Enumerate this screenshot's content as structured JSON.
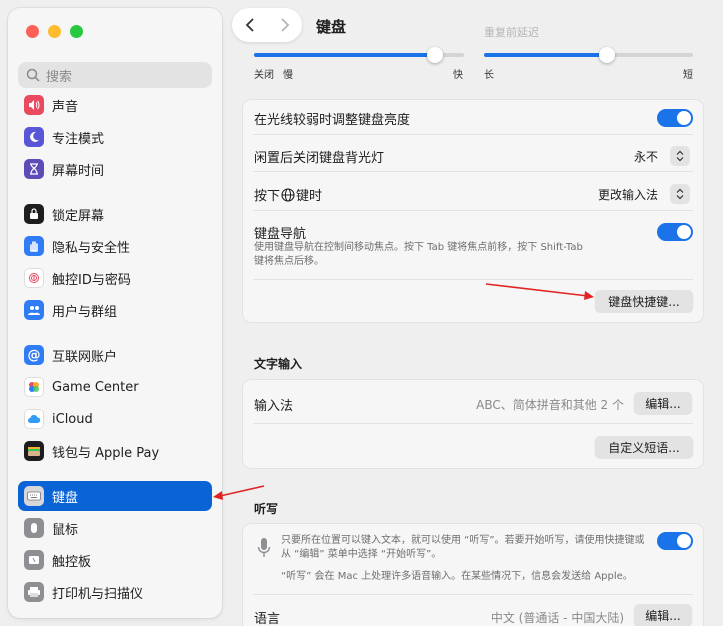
{
  "sidebar": {
    "search_placeholder": "搜索",
    "items": [
      {
        "label": "声音",
        "icon": "speaker-icon",
        "color": "#e84a5f"
      },
      {
        "label": "专注模式",
        "icon": "moon-icon",
        "color": "#5856d6"
      },
      {
        "label": "屏幕时间",
        "icon": "hourglass-icon",
        "color": "#5e4bb8"
      },
      {
        "label": "锁定屏幕",
        "icon": "lock-icon",
        "color": "#1d1d1f"
      },
      {
        "label": "隐私与安全性",
        "icon": "hand-icon",
        "color": "#2f7cf6"
      },
      {
        "label": "触控ID与密码",
        "icon": "fingerprint-icon",
        "color": "#ffffff"
      },
      {
        "label": "用户与群组",
        "icon": "users-icon",
        "color": "#2f7cf6"
      },
      {
        "label": "互联网账户",
        "icon": "at-icon",
        "color": "#2f7cf6"
      },
      {
        "label": "Game Center",
        "icon": "game-center-icon",
        "color": "#ffffff"
      },
      {
        "label": "iCloud",
        "icon": "cloud-icon",
        "color": "#ffffff"
      },
      {
        "label": "钱包与 Apple Pay",
        "icon": "wallet-icon",
        "color": "#1d1d1f"
      },
      {
        "label": "键盘",
        "icon": "keyboard-icon",
        "color": "#8e8e93",
        "active": true
      },
      {
        "label": "鼠标",
        "icon": "mouse-icon",
        "color": "#8e8e93"
      },
      {
        "label": "触控板",
        "icon": "trackpad-icon",
        "color": "#8e8e93"
      },
      {
        "label": "打印机与扫描仪",
        "icon": "printer-icon",
        "color": "#8e8e93"
      }
    ]
  },
  "header": {
    "title": "键盘",
    "faded_title": "重复前延迟"
  },
  "sliders": {
    "repeat": {
      "left_label": "关闭",
      "mid_label": "慢",
      "right_label": "快",
      "value_fraction": 0.86
    },
    "delay": {
      "left_label": "长",
      "right_label": "短",
      "value_fraction": 0.59
    }
  },
  "keyboard_card": {
    "adjust_brightness": {
      "label": "在光线较弱时调整键盘亮度",
      "on": true
    },
    "turn_off_backlight": {
      "label": "闲置后关闭键盘背光灯",
      "value": "永不"
    },
    "press_globe": {
      "label_prefix": "按下",
      "label_suffix": "键时",
      "value": "更改输入法"
    },
    "keyboard_nav": {
      "label": "键盘导航",
      "desc_line1": "使用键盘导航在控制间移动焦点。按下 Tab 键将焦点前移，按下 Shift-Tab",
      "desc_line2": "键将焦点后移。",
      "on": true
    },
    "shortcuts_button": "键盘快捷键..."
  },
  "text_input": {
    "section_title": "文字输入",
    "input_sources_label": "输入法",
    "input_sources_value": "ABC、简体拼音和其他 2 个",
    "edit_button": "编辑...",
    "text_replacements_button": "自定义短语..."
  },
  "dictation": {
    "section_title": "听写",
    "desc_line1": "只要所在位置可以键入文本，就可以使用 “听写”。若要开始听写，请使用快捷键或",
    "desc_line2": "从 “编辑” 菜单中选择 “开始听写”。",
    "desc_line3": "“听写” 会在 Mac 上处理许多语音输入。在某些情况下，信息会发送给 Apple。",
    "on": true,
    "language_label": "语言",
    "language_value": "中文 (普通话 - 中国大陆)",
    "edit_button": "编辑..."
  },
  "colors": {
    "accent": "#0a64d6",
    "toggle_on": "#1a73e8",
    "annotation_arrow": "#e02424"
  }
}
